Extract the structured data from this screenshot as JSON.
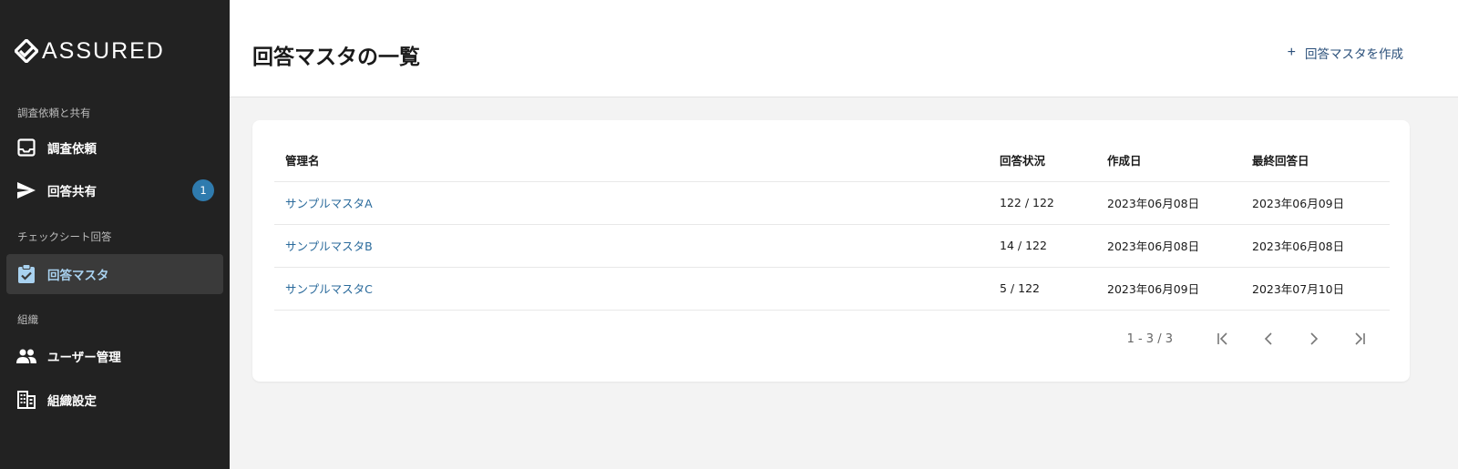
{
  "app": {
    "logo_text": "ASSURED"
  },
  "sidebar": {
    "sections": [
      {
        "label": "調査依頼と共有"
      },
      {
        "label": "チェックシート回答"
      },
      {
        "label": "組織"
      }
    ],
    "items": [
      {
        "label": "調査依頼",
        "icon": "inbox-icon"
      },
      {
        "label": "回答共有",
        "icon": "send-icon",
        "badge": "1"
      },
      {
        "label": "回答マスタ",
        "icon": "clipboard-check-icon",
        "active": true
      },
      {
        "label": "ユーザー管理",
        "icon": "people-icon"
      },
      {
        "label": "組織設定",
        "icon": "building-icon"
      }
    ]
  },
  "header": {
    "title": "回答マスタの一覧",
    "create_button": "回答マスタを作成"
  },
  "table": {
    "columns": [
      "管理名",
      "回答状況",
      "作成日",
      "最終回答日"
    ],
    "rows": [
      {
        "name": "サンプルマスタA",
        "status": "122 / 122",
        "created": "2023年06月08日",
        "last_answered": "2023年06月09日"
      },
      {
        "name": "サンプルマスタB",
        "status": "14 / 122",
        "created": "2023年06月08日",
        "last_answered": "2023年06月08日"
      },
      {
        "name": "サンプルマスタC",
        "status": "5 / 122",
        "created": "2023年06月09日",
        "last_answered": "2023年07月10日"
      }
    ]
  },
  "pagination": {
    "info": "1 - 3 / 3"
  },
  "colors": {
    "sidebar_bg": "#222222",
    "active_item_bg": "#3a3a3a",
    "active_text": "#a9d2f0",
    "badge": "#2f7bae",
    "link": "#2a6a9b",
    "create_button": "#2a4f7a"
  }
}
